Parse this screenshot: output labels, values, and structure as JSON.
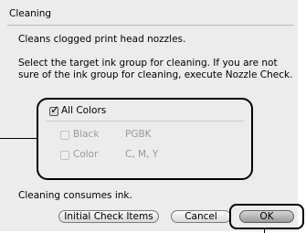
{
  "dialog": {
    "title": "Cleaning",
    "description": "Cleans clogged print head nozzles.",
    "instruction": "Select the target ink group for cleaning. If you are not sure of the ink group for cleaning, execute Nozzle Check.",
    "footer_note": "Cleaning consumes ink."
  },
  "ink_group": {
    "all_colors": {
      "label": "All Colors",
      "checked": true
    },
    "items": [
      {
        "label": "Black",
        "inks": "PGBK",
        "checked": false,
        "enabled": false
      },
      {
        "label": "Color",
        "inks": "C, M, Y",
        "checked": false,
        "enabled": false
      }
    ]
  },
  "buttons": {
    "initial_check": "Initial Check Items",
    "cancel": "Cancel",
    "ok": "OK"
  }
}
